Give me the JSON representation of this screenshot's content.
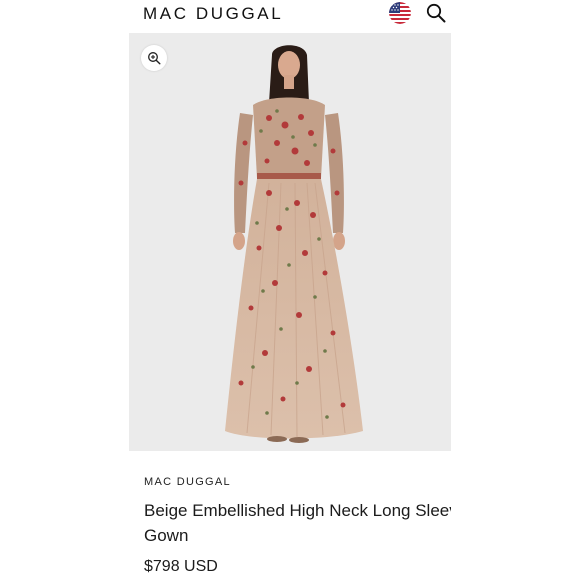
{
  "header": {
    "logo": "MAC DUGGAL",
    "flag_icon": "us-flag-icon",
    "search_icon": "search-icon"
  },
  "product": {
    "image_icon": "zoom-in-icon",
    "brand": "MAC DUGGAL",
    "title": "Beige Embellished High Neck Long Sleeve Gown",
    "price": "$798 USD"
  },
  "colors": {
    "background": "#ffffff",
    "image_bg": "#ebebeb",
    "text": "#1b1b1b",
    "dress_tulle": "#d9b9a2",
    "embroidery_red": "#b23a3a",
    "embroidery_green": "#6f7a4a"
  }
}
